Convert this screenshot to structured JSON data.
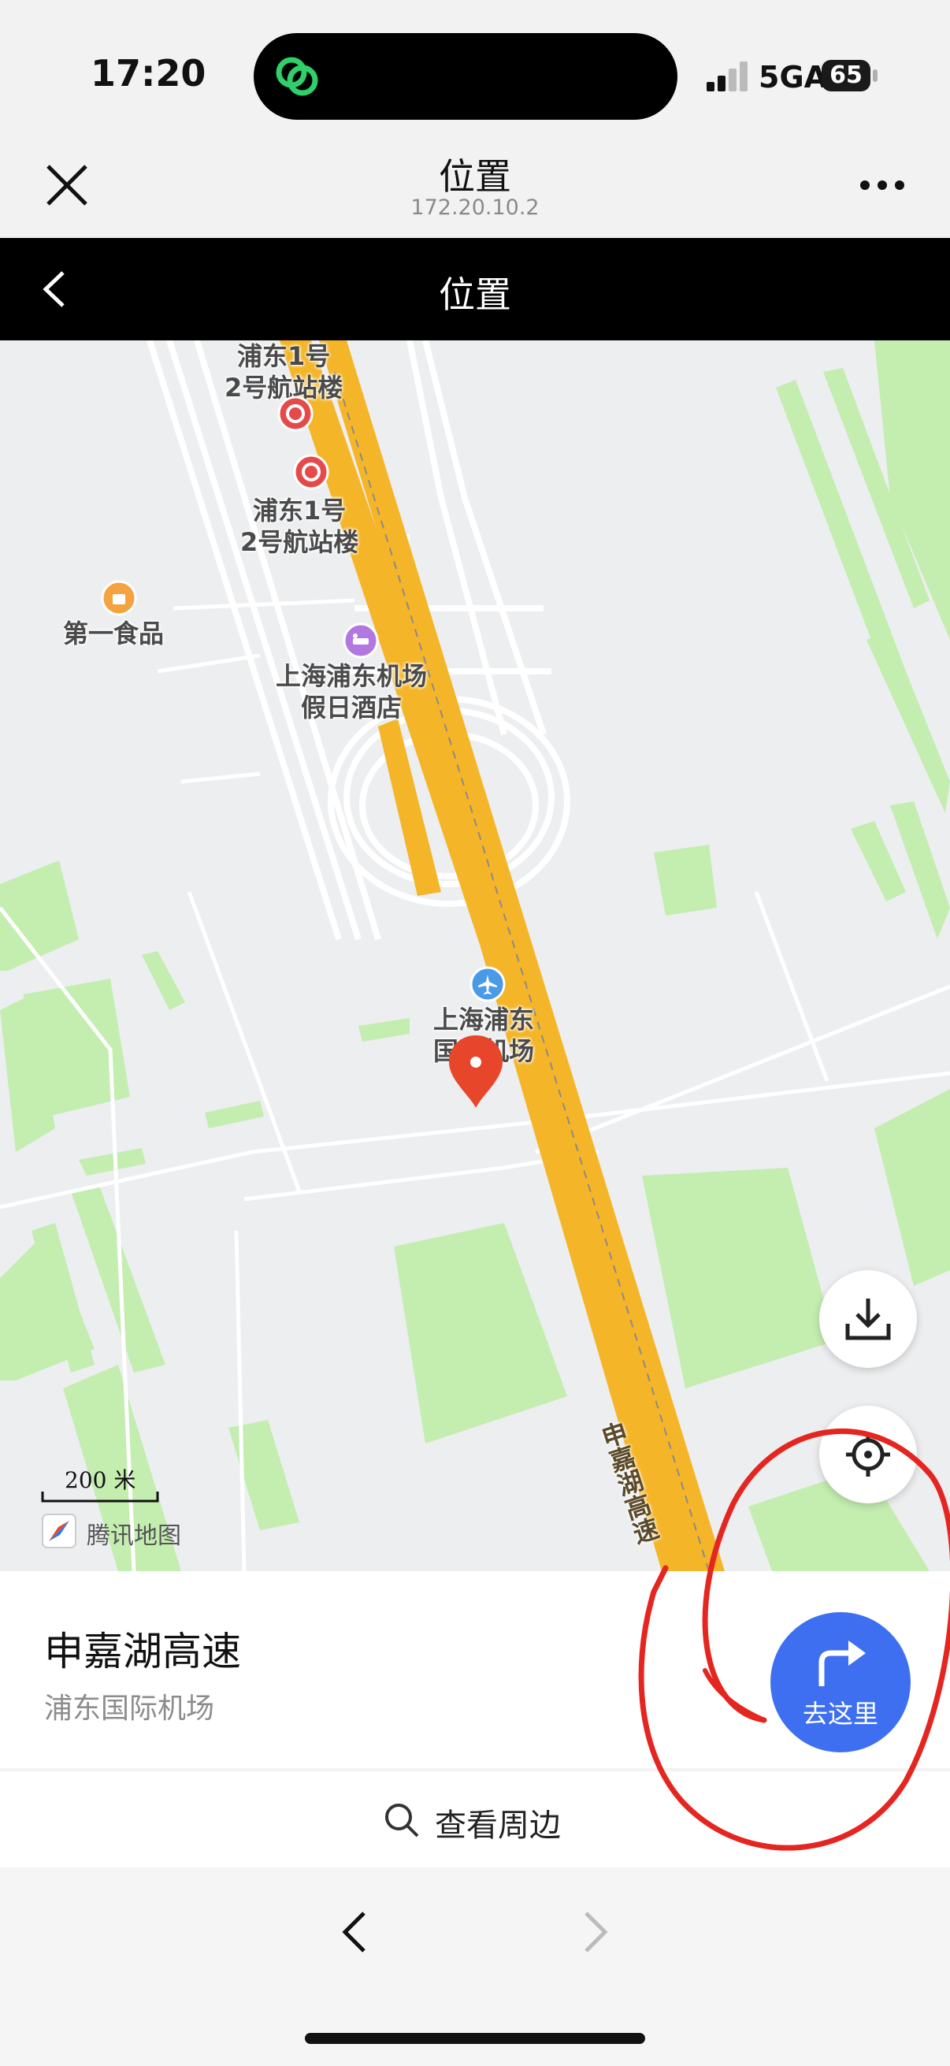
{
  "status_bar": {
    "time": "17:20",
    "network": "5GA",
    "battery": "65",
    "icons": [
      "wechat-island-icon",
      "signal-icon",
      "battery-icon"
    ]
  },
  "nav": {
    "title": "位置",
    "subtitle": "172.20.10.2",
    "icons": [
      "close-icon",
      "more-icon"
    ]
  },
  "page_header": {
    "title": "位置",
    "icons": [
      "back-icon"
    ]
  },
  "map": {
    "labels": {
      "terminal_top": "浦东1号\n2号航站楼",
      "terminal_mid": "浦东1号\n2号航站楼",
      "food": "第一食品",
      "hotel": "上海浦东机场\n假日酒店",
      "airport": "上海浦东\n国际机场",
      "road": "申嘉湖高速"
    },
    "scale": "200 米",
    "attribution": "腾讯地图",
    "colors": {
      "road": "#f5b528",
      "green": "#c4edb0",
      "pin": "#e8462a",
      "background": "#eceef0"
    },
    "icons": [
      "metro-icon",
      "shopping-icon",
      "hotel-icon",
      "airport-icon",
      "location-pin-icon",
      "download-icon",
      "locate-icon",
      "tencent-map-logo-icon"
    ]
  },
  "location": {
    "name": "申嘉湖高速",
    "address": "浦东国际机场",
    "go_label": "去这里",
    "accent": "#3d6ff0"
  },
  "nearby": {
    "label": "查看周边"
  },
  "toolbar": {
    "icons": [
      "back-arrow-icon",
      "forward-arrow-icon"
    ]
  },
  "annotation": {
    "color": "#e52520"
  }
}
